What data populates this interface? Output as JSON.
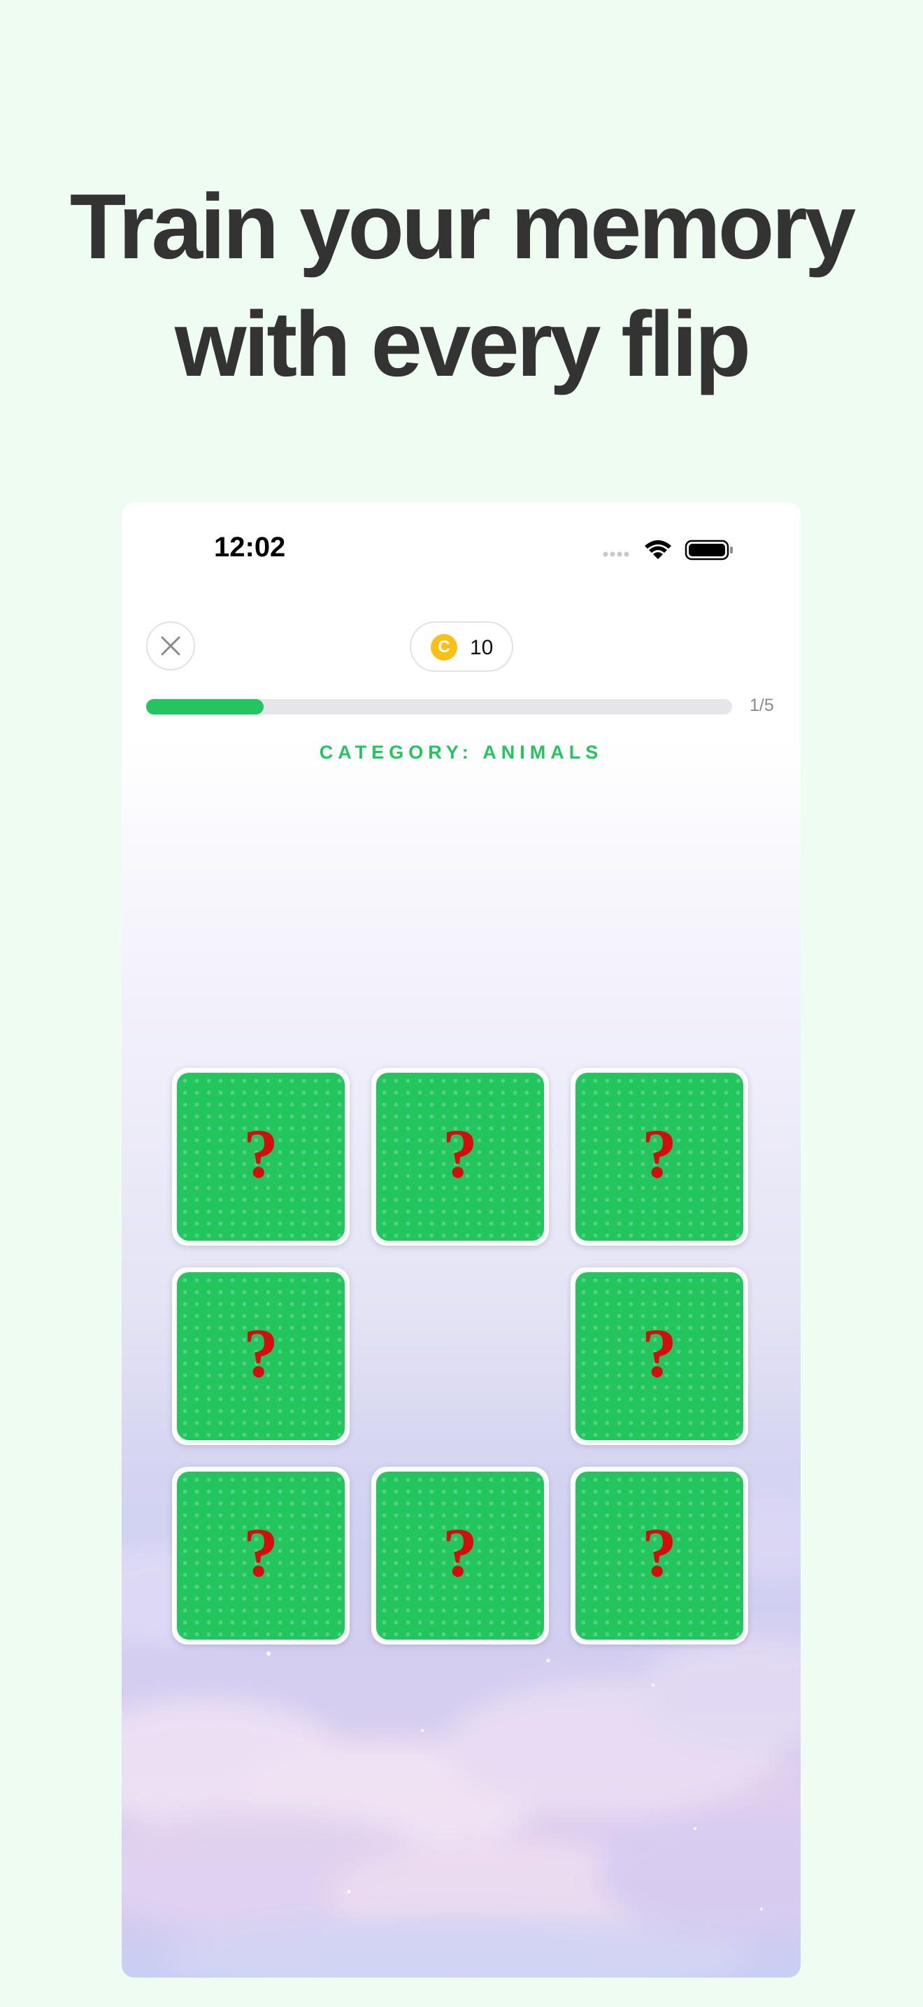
{
  "headline": {
    "line1": "Train your memory",
    "line2": "with every flip"
  },
  "status_bar": {
    "time": "12:02",
    "icons": [
      "signal-icon",
      "wifi-icon",
      "battery-icon"
    ]
  },
  "header": {
    "close_icon": "close-icon",
    "coin_symbol": "C",
    "coins": "10"
  },
  "progress": {
    "current": 1,
    "total": 5,
    "fraction": 0.2,
    "label": "1/5"
  },
  "category_label": "CATEGORY: ANIMALS",
  "board": {
    "rows": 3,
    "columns": 3,
    "cards": [
      {
        "state": "face-down",
        "symbol": "?"
      },
      {
        "state": "face-down",
        "symbol": "?"
      },
      {
        "state": "face-down",
        "symbol": "?"
      },
      {
        "state": "face-down",
        "symbol": "?"
      },
      {
        "state": "empty",
        "symbol": ""
      },
      {
        "state": "face-down",
        "symbol": "?"
      },
      {
        "state": "face-down",
        "symbol": "?"
      },
      {
        "state": "face-down",
        "symbol": "?"
      },
      {
        "state": "face-down",
        "symbol": "?"
      }
    ]
  },
  "colors": {
    "page_background": "#effcf2",
    "accent_green": "#22c55e",
    "question_mark": "#d40d0d",
    "coin": "#f7c11a",
    "headline": "#333333"
  }
}
